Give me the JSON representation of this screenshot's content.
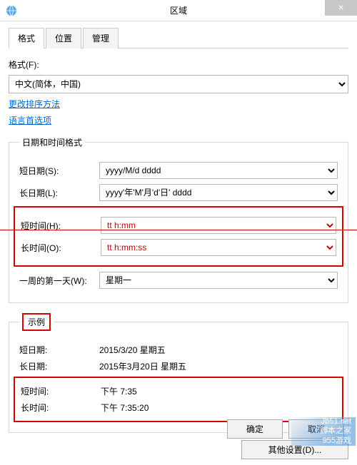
{
  "titlebar": {
    "title": "区域",
    "close": "×"
  },
  "tabs": {
    "format": "格式",
    "location": "位置",
    "admin": "管理"
  },
  "format_label": "格式(F):",
  "format_value": "中文(简体，中国)",
  "links": {
    "sort": "更改排序方法",
    "lang": "语言首选项"
  },
  "dt_group": {
    "legend": "日期和时间格式",
    "short_date_label": "短日期(S):",
    "short_date_val": "yyyy/M/d dddd",
    "long_date_label": "长日期(L):",
    "long_date_val": "yyyy'年'M'月'd'日' dddd",
    "short_time_label": "短时间(H):",
    "short_time_val": "tt h:mm",
    "long_time_label": "长时间(O):",
    "long_time_val": "tt h:mm:ss",
    "first_day_label": "一周的第一天(W):",
    "first_day_val": "星期一"
  },
  "example": {
    "legend": "示例",
    "short_date_label": "短日期:",
    "short_date_val": "2015/3/20 星期五",
    "long_date_label": "长日期:",
    "long_date_val": "2015年3月20日 星期五",
    "short_time_label": "短时间:",
    "short_time_val": "下午 7:35",
    "long_time_label": "长时间:",
    "long_time_val": "下午 7:35:20"
  },
  "other_settings": "其他设置(D)...",
  "buttons": {
    "ok": "确定",
    "cancel": "取消"
  },
  "watermark": {
    "l1": "Jb51.net",
    "l2": "脚本之家",
    "l3": "955游戏"
  }
}
